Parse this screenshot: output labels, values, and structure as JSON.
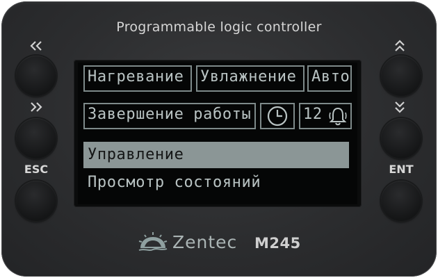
{
  "device": {
    "title": "Programmable logic controller",
    "brand": "Zentec",
    "model": "M245"
  },
  "buttons": {
    "left": [
      {
        "label": "",
        "icon": "double-chevron-left-icon"
      },
      {
        "label": "",
        "icon": "double-chevron-right-icon"
      },
      {
        "label": "ESC",
        "icon": ""
      }
    ],
    "right": [
      {
        "label": "",
        "icon": "double-chevron-up-icon"
      },
      {
        "label": "",
        "icon": "double-chevron-down-icon"
      },
      {
        "label": "ENT",
        "icon": ""
      }
    ]
  },
  "screen": {
    "top_row": [
      "Нагревание",
      "Увлажнение",
      "Авто"
    ],
    "second_row": {
      "status": "Завершение работы",
      "clock_icon": "clock-icon",
      "alarm_count": "12",
      "bell_icon": "bell-icon"
    },
    "menu": [
      {
        "label": "Управление",
        "selected": true
      },
      {
        "label": "Просмотр состояний",
        "selected": false
      }
    ]
  },
  "colors": {
    "body": "#2c2d2f",
    "screen_bg": "#050606",
    "lcd_text": "#b9c3c3",
    "selection": "#8b9696"
  }
}
